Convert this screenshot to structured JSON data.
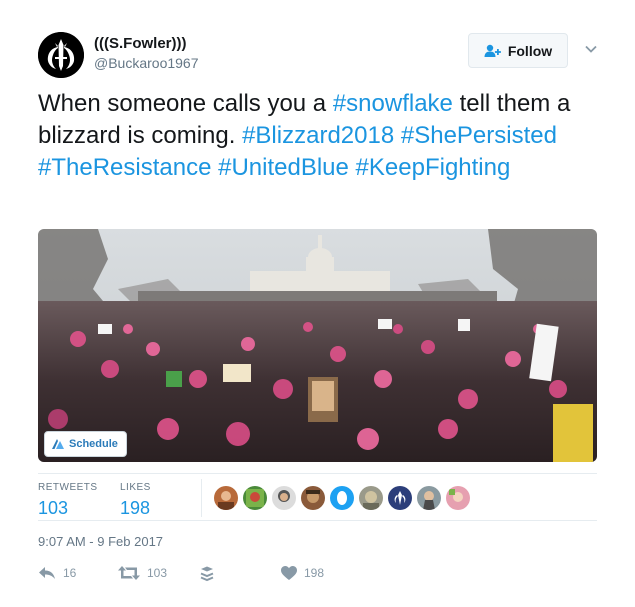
{
  "user": {
    "full_name": "(((S.Fowler)))",
    "screen_name": "@Buckaroo1967"
  },
  "follow_button": {
    "label": "Follow"
  },
  "tweet": {
    "segments": [
      {
        "text": "When someone calls you a ",
        "highlight": false
      },
      {
        "text": "#snowflake",
        "highlight": true
      },
      {
        "text": " tell them a blizzard is coming. ",
        "highlight": false
      },
      {
        "text": "#Blizzard2018",
        "highlight": true
      },
      {
        "text": " ",
        "highlight": false
      },
      {
        "text": "#ShePersisted",
        "highlight": true
      },
      {
        "text": " ",
        "highlight": false
      },
      {
        "text": "#TheResistance",
        "highlight": true
      },
      {
        "text": " ",
        "highlight": false
      },
      {
        "text": "#UnitedBlue",
        "highlight": true
      },
      {
        "text": " ",
        "highlight": false
      },
      {
        "text": "#KeepFighting",
        "highlight": true
      }
    ]
  },
  "media": {
    "schedule_label": "Schedule"
  },
  "stats": {
    "retweets_label": "RETWEETS",
    "retweets_value": "103",
    "likes_label": "LIKES",
    "likes_value": "198"
  },
  "timestamp": "9:07 AM - 9 Feb 2017",
  "actions": {
    "reply_count": "16",
    "retweet_count": "103",
    "like_count": "198"
  },
  "colors": {
    "link": "#1b95e0",
    "text": "#14171a",
    "muted": "#657786",
    "icon": "#8899a6",
    "border": "#e6ecf0"
  }
}
